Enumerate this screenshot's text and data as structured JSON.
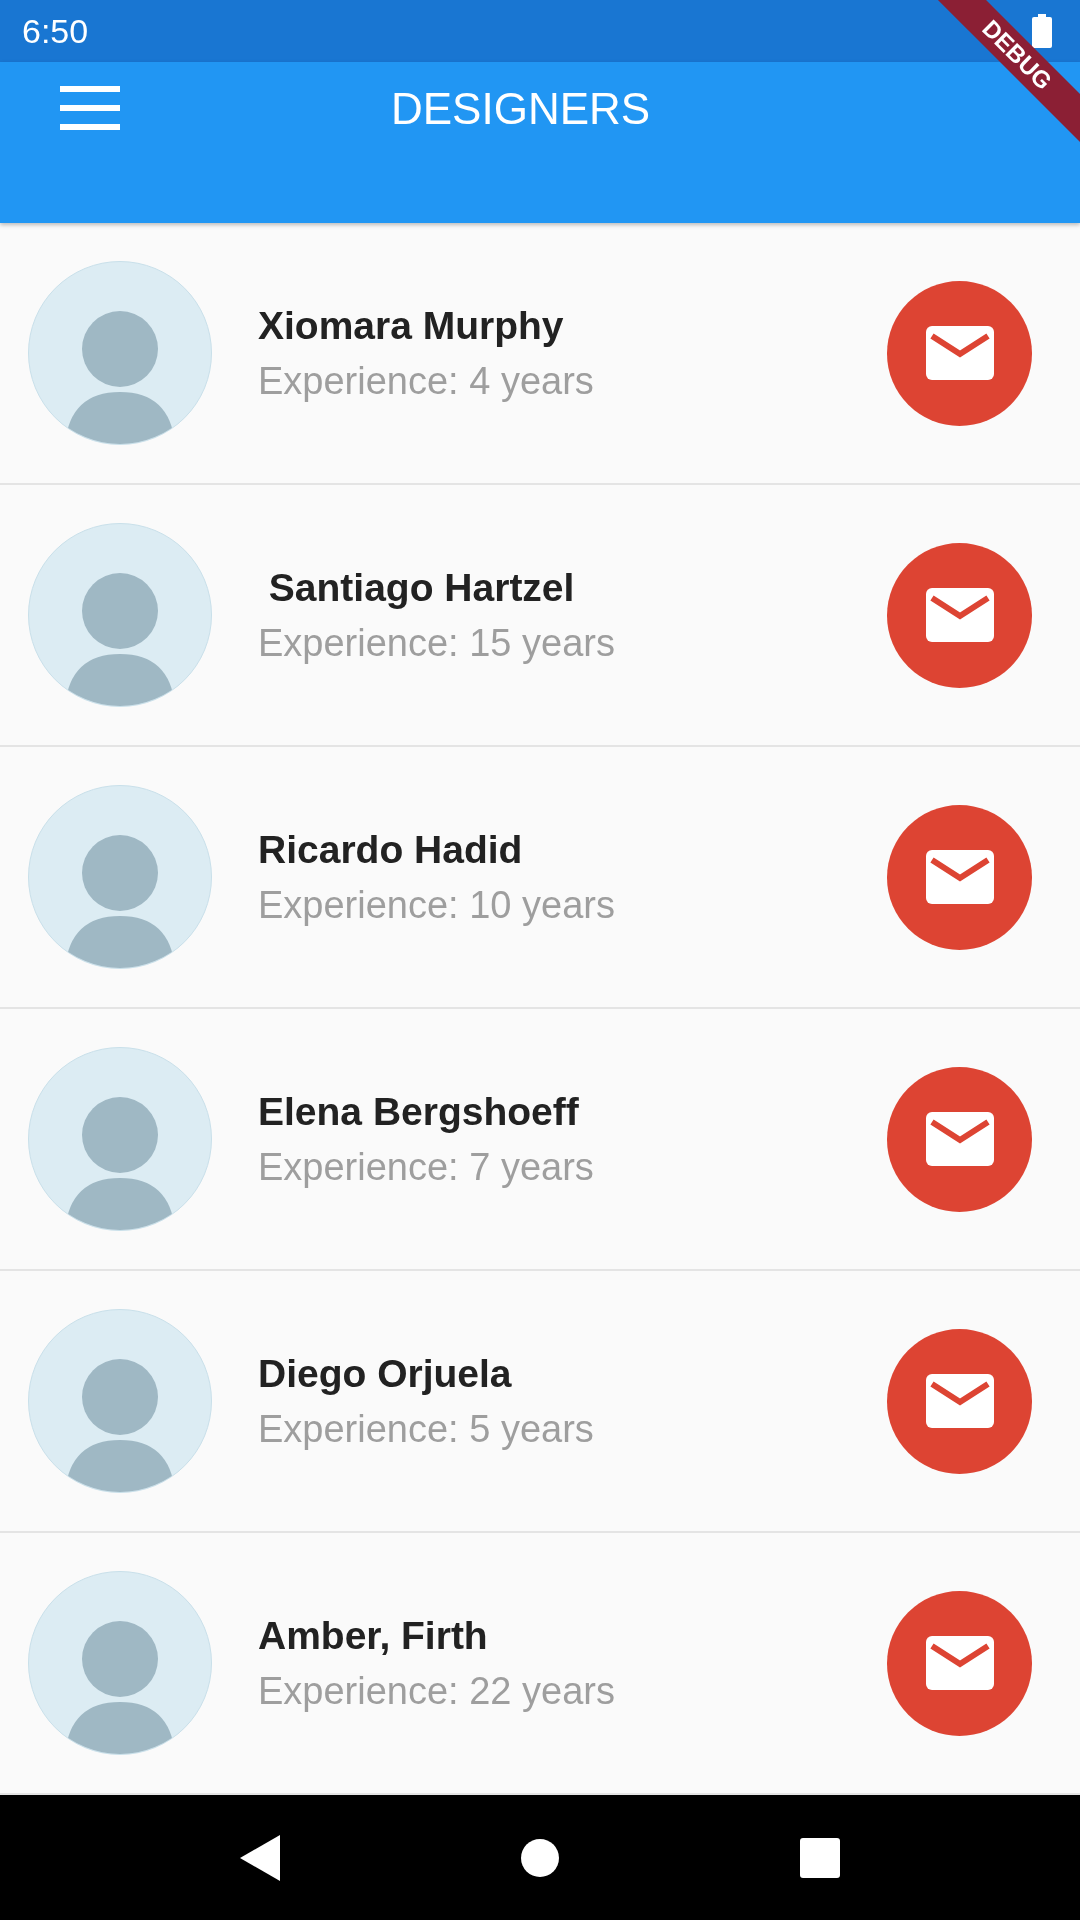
{
  "status_bar": {
    "time": "6:50"
  },
  "debug_banner": "DEBUG",
  "app_bar": {
    "title": "DESIGNERS"
  },
  "designers": [
    {
      "name": "Xiomara Murphy",
      "experience": "Experience: 4 years"
    },
    {
      "name": " Santiago Hartzel",
      "experience": "Experience: 15 years"
    },
    {
      "name": "Ricardo Hadid",
      "experience": "Experience: 10 years"
    },
    {
      "name": "Elena Bergshoeff",
      "experience": "Experience: 7 years"
    },
    {
      "name": "Diego Orjuela",
      "experience": "Experience: 5 years"
    },
    {
      "name": "Amber, Firth",
      "experience": "Experience: 22 years"
    }
  ]
}
